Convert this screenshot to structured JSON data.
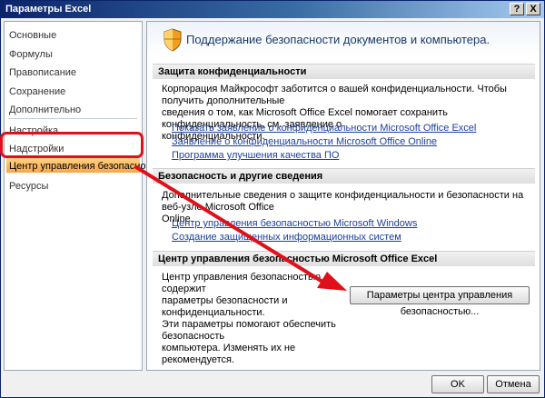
{
  "window": {
    "title": "Параметры Excel",
    "help_label": "?",
    "close_label": "X"
  },
  "sidebar": {
    "items": [
      {
        "label": "Основные"
      },
      {
        "label": "Формулы"
      },
      {
        "label": "Правописание"
      },
      {
        "label": "Сохранение"
      },
      {
        "label": "Дополнительно"
      },
      {
        "label": "Настройка"
      },
      {
        "label": "Надстройки"
      },
      {
        "label": "Центр управления безопасностью"
      },
      {
        "label": "Ресурсы"
      }
    ],
    "selected_index": 7
  },
  "main": {
    "header_title": "Поддержание безопасности документов и компьютера.",
    "sections": [
      {
        "title": "Защита конфиденциальности",
        "text_lines": [
          "Корпорация Майкрософт заботится о вашей конфиденциальности. Чтобы получить дополнительные",
          "сведения о том, как Microsoft Office Excel помогает сохранить конфиденциальность, см. заявление о",
          "конфиденциальности."
        ],
        "links": [
          "Показать заявление о конфиденциальности Microsoft Office Excel",
          "Заявление о конфиденциальности Microsoft Office Online",
          "Программа улучшения качества ПО"
        ]
      },
      {
        "title": "Безопасность и другие сведения",
        "text_lines": [
          "Дополнительные сведения о защите конфиденциальности и безопасности на веб-узле Microsoft Office",
          "Online."
        ],
        "links": [
          "Центр управления безопасностью Microsoft Windows",
          "Создание защищенных информационных систем"
        ]
      },
      {
        "title": "Центр управления безопасностью Microsoft Office Excel",
        "text_lines": [
          "Центр управления безопасностью содержит",
          "параметры безопасности и конфиденциальности.",
          "Эти параметры помогают обеспечить безопасность",
          "компьютера. Изменять их не рекомендуется."
        ],
        "button_label": "Параметры центра управления безопасностью..."
      }
    ]
  },
  "footer": {
    "ok_label": "OK",
    "cancel_label": "Отмена"
  },
  "colors": {
    "annotation_red": "#e0101a",
    "selection": "#f8a548",
    "link": "#1a3f9e"
  }
}
